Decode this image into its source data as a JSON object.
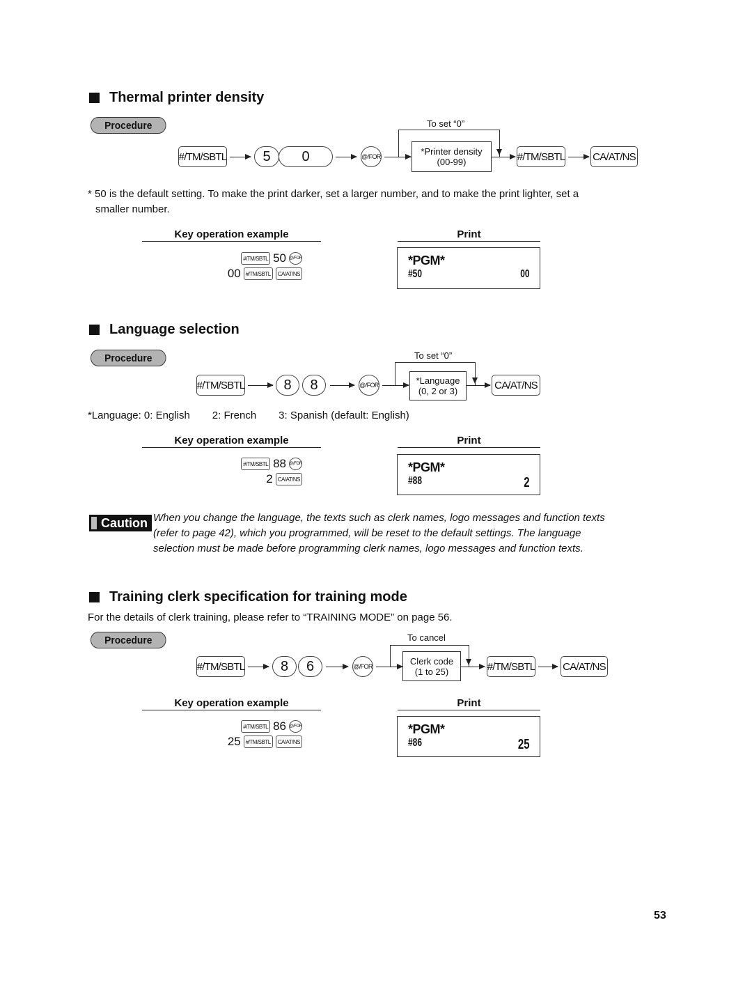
{
  "page_number": "53",
  "common": {
    "procedure_label": "Procedure",
    "key_op_heading": "Key operation example",
    "print_heading": "Print",
    "key_tm_sbtl": "#/TM/SBTL",
    "key_ca_at_ns": "CA/AT/NS",
    "key_at_for": "@/FOR",
    "pgm_header": "*PGM*"
  },
  "sections": [
    {
      "title": "Thermal printer density",
      "digits": [
        "5",
        "0"
      ],
      "bypass_label": "To set “0”",
      "input_line1": "*Printer density",
      "input_line2": "(00-99)",
      "note_line1": "* 50 is the default setting.  To make the print darker, set a larger number, and to make the print lighter, set a",
      "note_line2": "smaller number.",
      "key_example": {
        "line1_value": "50",
        "line2_value": "00"
      },
      "receipt": {
        "code": "#50",
        "value": "00"
      }
    },
    {
      "title": "Language selection",
      "digits": [
        "8",
        "8"
      ],
      "bypass_label": "To set “0”",
      "input_line1": "*Language",
      "input_line2": "(0, 2 or 3)",
      "language_options": [
        "*Language: 0: English",
        "2: French",
        "3: Spanish  (default: English)"
      ],
      "key_example": {
        "line1_value": "88",
        "line2_value": "2"
      },
      "receipt": {
        "code": "#88",
        "value": "2"
      },
      "caution_label": "Caution",
      "caution_lines": [
        "When you change the language, the texts such as clerk names, logo messages and function texts",
        "(refer to page 42), which you programmed, will be reset to the default settings.  The language",
        "selection must be made before programming clerk names, logo messages and function texts."
      ]
    },
    {
      "title": "Training clerk specification for training mode",
      "intro": "For the details of clerk training, please refer to “TRAINING MODE” on page 56.",
      "digits": [
        "8",
        "6"
      ],
      "bypass_label": "To cancel",
      "input_line1": "Clerk code",
      "input_line2": "(1 to 25)",
      "key_example": {
        "line1_value": "86",
        "line2_value": "25"
      },
      "receipt": {
        "code": "#86",
        "value": "25"
      }
    }
  ]
}
